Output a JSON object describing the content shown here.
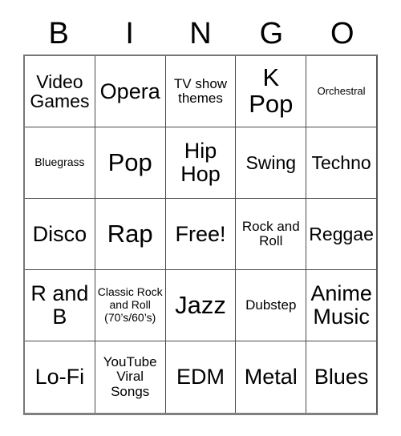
{
  "card": {
    "header_letters": [
      "B",
      "I",
      "N",
      "G",
      "O"
    ],
    "rows": [
      [
        {
          "text": "Video Games",
          "size": "sz-md"
        },
        {
          "text": "Opera",
          "size": "sz-lg"
        },
        {
          "text": "TV show themes",
          "size": "sz-sm"
        },
        {
          "text": "K Pop",
          "size": "sz-xl"
        },
        {
          "text": "Orchestral",
          "size": "sz-xxs"
        }
      ],
      [
        {
          "text": "Bluegrass",
          "size": "sz-xs"
        },
        {
          "text": "Pop",
          "size": "sz-xl"
        },
        {
          "text": "Hip Hop",
          "size": "sz-lg"
        },
        {
          "text": "Swing",
          "size": "sz-md"
        },
        {
          "text": "Techno",
          "size": "sz-md"
        }
      ],
      [
        {
          "text": "Disco",
          "size": "sz-lg"
        },
        {
          "text": "Rap",
          "size": "sz-xl"
        },
        {
          "text": "Free!",
          "size": "sz-lg"
        },
        {
          "text": "Rock and Roll",
          "size": "sz-sm"
        },
        {
          "text": "Reggae",
          "size": "sz-md"
        }
      ],
      [
        {
          "text": "R and B",
          "size": "sz-lg"
        },
        {
          "text": "Classic Rock and Roll (70’s/60’s)",
          "size": "sz-xs"
        },
        {
          "text": "Jazz",
          "size": "sz-xl"
        },
        {
          "text": "Dubstep",
          "size": "sz-sm"
        },
        {
          "text": "Anime Music",
          "size": "sz-lg"
        }
      ],
      [
        {
          "text": "Lo-Fi",
          "size": "sz-lg"
        },
        {
          "text": "YouTube Viral Songs",
          "size": "sz-sm"
        },
        {
          "text": "EDM",
          "size": "sz-lg"
        },
        {
          "text": "Metal",
          "size": "sz-lg"
        },
        {
          "text": "Blues",
          "size": "sz-lg"
        }
      ]
    ]
  }
}
